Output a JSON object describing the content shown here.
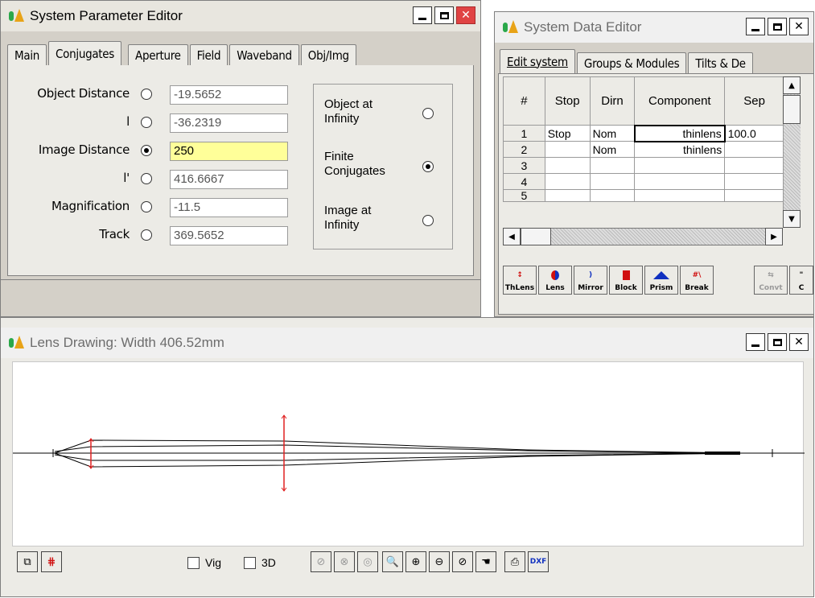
{
  "param_editor": {
    "title": "System Parameter Editor",
    "tabs": [
      "Main",
      "Conjugates",
      "Aperture",
      "Field",
      "Waveband",
      "Obj/Img"
    ],
    "selected_tab": "Conjugates",
    "rows": [
      {
        "label": "Object Distance",
        "value": "-19.5652",
        "selected": false
      },
      {
        "label": "l",
        "value": "-36.2319",
        "selected": false
      },
      {
        "label": "Image Distance",
        "value": "250",
        "selected": true
      },
      {
        "label": "l'",
        "value": "416.6667",
        "selected": false
      },
      {
        "label": "Magnification",
        "value": "-11.5",
        "selected": false
      },
      {
        "label": "Track",
        "value": "369.5652",
        "selected": false
      }
    ],
    "conjugate_options": [
      {
        "label_line1": "Object at",
        "label_line2": "Infinity",
        "selected": false
      },
      {
        "label_line1": "Finite",
        "label_line2": "Conjugates",
        "selected": true
      },
      {
        "label_line1": "Image at",
        "label_line2": "Infinity",
        "selected": false
      }
    ]
  },
  "data_editor": {
    "title": "System Data Editor",
    "tabs": [
      "Edit system",
      "Groups & Modules",
      "Tilts & De"
    ],
    "columns": [
      "#",
      "Stop",
      "Dirn",
      "Component",
      "Sep"
    ],
    "rows": [
      {
        "n": "1",
        "stop": "Stop",
        "dirn": "Nom",
        "component": "thinlens",
        "sep": "100.0"
      },
      {
        "n": "2",
        "stop": "",
        "dirn": "Nom",
        "component": "thinlens",
        "sep": ""
      },
      {
        "n": "3",
        "stop": "",
        "dirn": "",
        "component": "",
        "sep": ""
      },
      {
        "n": "4",
        "stop": "",
        "dirn": "",
        "component": "",
        "sep": ""
      },
      {
        "n": "5",
        "stop": "",
        "dirn": "",
        "component": "",
        "sep": ""
      }
    ],
    "toolbar": [
      "ThLens",
      "Lens",
      "Mirror",
      "Block",
      "Prism",
      "Break",
      "Convt",
      "C"
    ]
  },
  "lens_drawing": {
    "title": "Lens Drawing: Width  406.52mm",
    "vig_label": "Vig",
    "three_d_label": "3D",
    "dxf_label": "DXF"
  },
  "colors": {
    "edit_highlight": "#ffff99",
    "lens_marker": "#e02020",
    "close_button": "#e04343"
  }
}
